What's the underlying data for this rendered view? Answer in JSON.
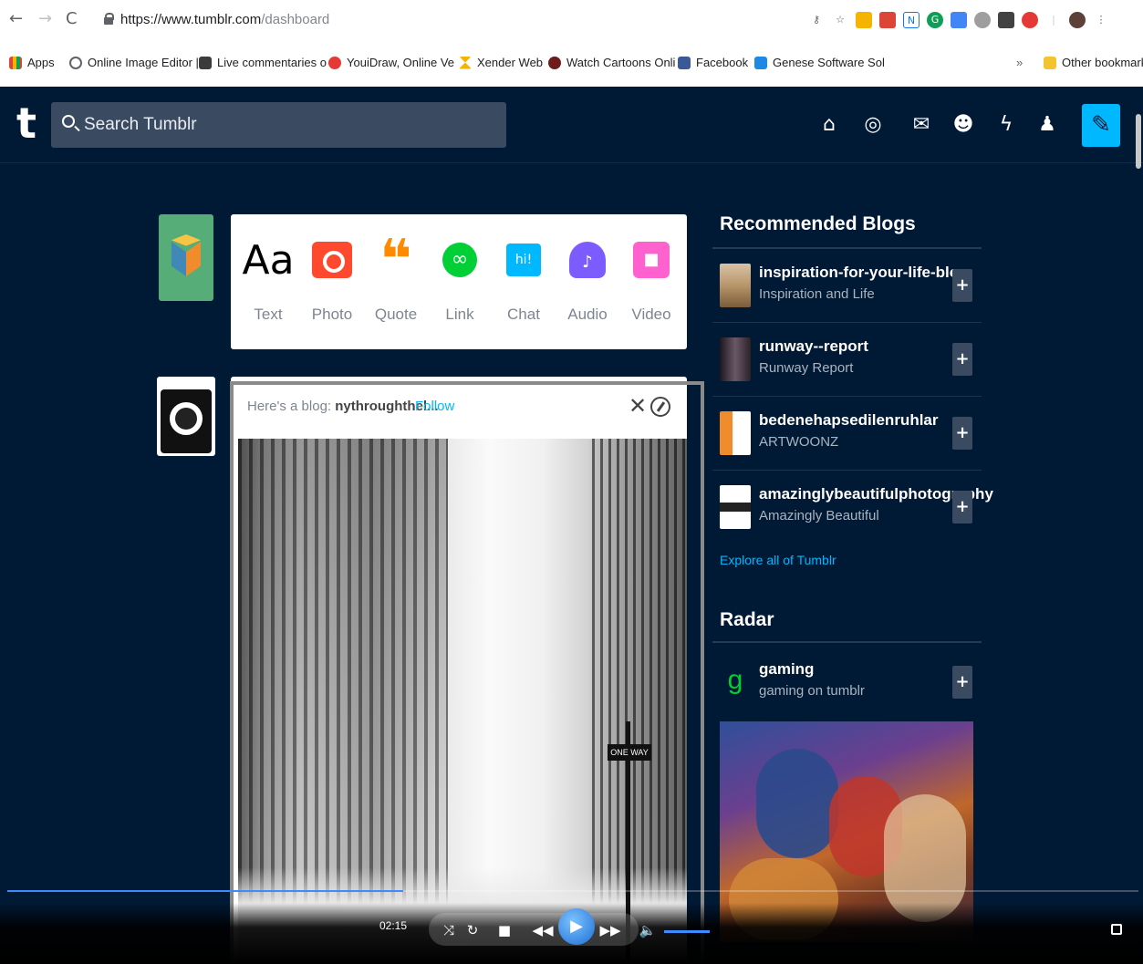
{
  "browser": {
    "url_host": "https://www.tumblr.com",
    "url_path": "/dashboard",
    "bookmarks": [
      {
        "label": "Apps"
      },
      {
        "label": "Online Image Editor |"
      },
      {
        "label": "Live commentaries o"
      },
      {
        "label": "YouiDraw, Online Ve"
      },
      {
        "label": "Xender Web"
      },
      {
        "label": "Watch Cartoons Onli"
      },
      {
        "label": "Facebook"
      },
      {
        "label": "Genese Software Sol"
      }
    ],
    "overflow": "»",
    "other_bookmarks": "Other bookmarks"
  },
  "header": {
    "logo": "t",
    "search_placeholder": "Search Tumblr",
    "nav_icons": [
      "home-icon",
      "explore-icon",
      "inbox-icon",
      "messaging-icon",
      "activity-icon",
      "account-icon"
    ],
    "compose_icon": "pencil-icon"
  },
  "post_types": [
    {
      "label": "Text",
      "glyph": "Aa",
      "color": "#000000"
    },
    {
      "label": "Photo",
      "glyph": "",
      "color": "#ff492f"
    },
    {
      "label": "Quote",
      "glyph": "66",
      "color": "#ff8a00"
    },
    {
      "label": "Link",
      "glyph": "∞",
      "color": "#00cf35"
    },
    {
      "label": "Chat",
      "glyph": "hi!",
      "color": "#00b8ff"
    },
    {
      "label": "Audio",
      "glyph": "♪",
      "color": "#7c5cff"
    },
    {
      "label": "Video",
      "glyph": "■",
      "color": "#ff62ce"
    }
  ],
  "featured": {
    "prefix": "Here's a blog:",
    "blog": "nythroughthel...",
    "follow": "Follow",
    "close": "✕"
  },
  "player": {
    "time": "02:15",
    "progress": 0.35
  },
  "sidebar": {
    "recommended_title": "Recommended Blogs",
    "blogs": [
      {
        "name": "inspiration-for-your-life-blog",
        "sub": "Inspiration and Life",
        "thumb": "#b8956a"
      },
      {
        "name": "runway--report",
        "sub": "Runway Report",
        "thumb": "#3a2f3a"
      },
      {
        "name": "bedenehapsedilenruhlar",
        "sub": "ARTWOONZ",
        "thumb": "#ffffff"
      },
      {
        "name": "amazinglybeautifulphotography",
        "sub": "Amazingly Beautiful",
        "thumb": "#ffffff"
      }
    ],
    "explore": "Explore all of Tumblr",
    "radar_title": "Radar",
    "radar": {
      "name": "gaming",
      "sub": "gaming on tumblr",
      "glyph": "g"
    },
    "plus": "+"
  }
}
